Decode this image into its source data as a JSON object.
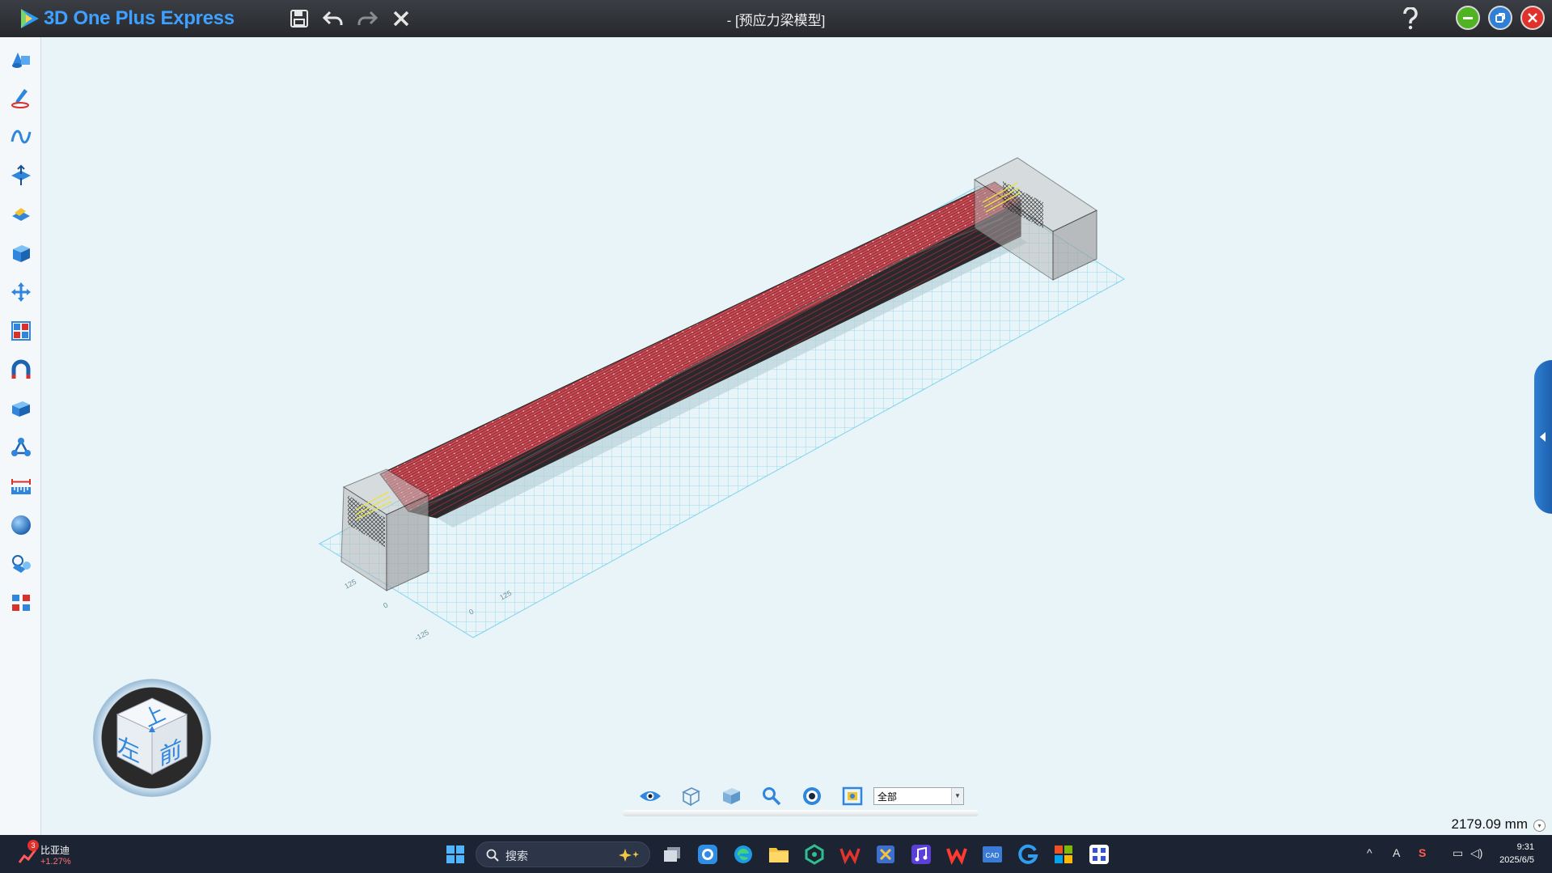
{
  "app": {
    "name": "3D One Plus Express",
    "title": "- [预应力梁模型]"
  },
  "left_tools": [
    {
      "icon": "primitive-shapes-icon"
    },
    {
      "icon": "sketch-pen-icon"
    },
    {
      "icon": "curve-icon"
    },
    {
      "icon": "feature-icon"
    },
    {
      "icon": "special-feature-icon"
    },
    {
      "icon": "solid-box-icon"
    },
    {
      "icon": "move-icon"
    },
    {
      "icon": "pattern-icon"
    },
    {
      "icon": "magnet-adsorb-icon"
    },
    {
      "icon": "combine-icon"
    },
    {
      "icon": "assembly-icon"
    },
    {
      "icon": "measure-ruler-icon"
    },
    {
      "icon": "render-sphere-icon"
    },
    {
      "icon": "library-icon"
    },
    {
      "icon": "plugin-icon"
    }
  ],
  "view_cube": {
    "top": "上",
    "left": "左",
    "front": "前"
  },
  "grid_labels": [
    "125",
    "0",
    "0",
    "125",
    "-125"
  ],
  "view_toolbar": {
    "filter_value": "全部"
  },
  "status": {
    "measure": "2179.09 mm"
  },
  "taskbar": {
    "stock_badge": "3",
    "stock_name": "比亚迪",
    "stock_change": "+1.27%",
    "search_placeholder": "搜索",
    "tray_lang": "A",
    "time": "9:31",
    "date": "2025/6/5"
  },
  "colors": {
    "accent": "#2f86dc",
    "viewport_bg": "#e9f4f8",
    "rebar_red": "#d9434d",
    "grid": "#7fd3ec"
  }
}
